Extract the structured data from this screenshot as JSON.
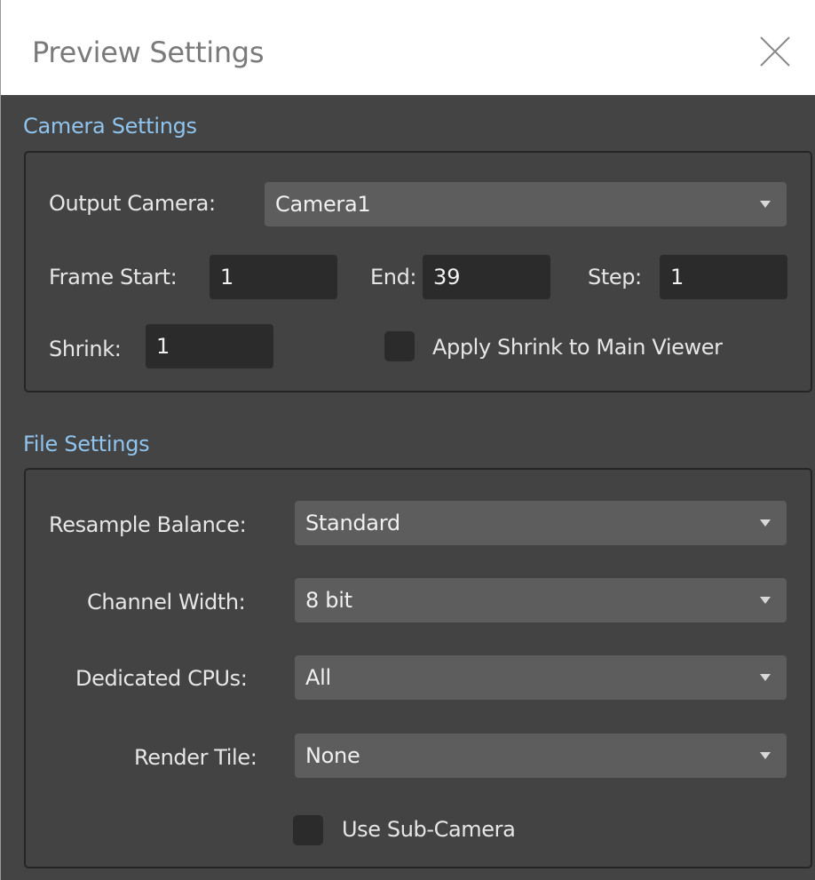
{
  "window": {
    "title": "Preview Settings",
    "close_icon": "close-icon"
  },
  "camera_settings": {
    "title": "Camera Settings",
    "output_camera_label": "Output Camera:",
    "output_camera_value": "Camera1",
    "frame_start_label": "Frame Start:",
    "frame_start_value": "1",
    "end_label": "End:",
    "end_value": "39",
    "step_label": "Step:",
    "step_value": "1",
    "shrink_label": "Shrink:",
    "shrink_value": "1",
    "apply_shrink_label": "Apply Shrink to Main Viewer",
    "apply_shrink_checked": false
  },
  "file_settings": {
    "title": "File Settings",
    "resample_balance_label": "Resample Balance:",
    "resample_balance_value": "Standard",
    "channel_width_label": "Channel Width:",
    "channel_width_value": "8 bit",
    "dedicated_cpus_label": "Dedicated CPUs:",
    "dedicated_cpus_value": "All",
    "render_tile_label": "Render Tile:",
    "render_tile_value": "None",
    "use_sub_camera_label": "Use Sub-Camera",
    "use_sub_camera_checked": false
  },
  "colors": {
    "panel_bg": "#444444",
    "section_title": "#8fc4ee",
    "field_bg": "#2b2b2b",
    "dropdown_bg": "#5d5d5d"
  }
}
